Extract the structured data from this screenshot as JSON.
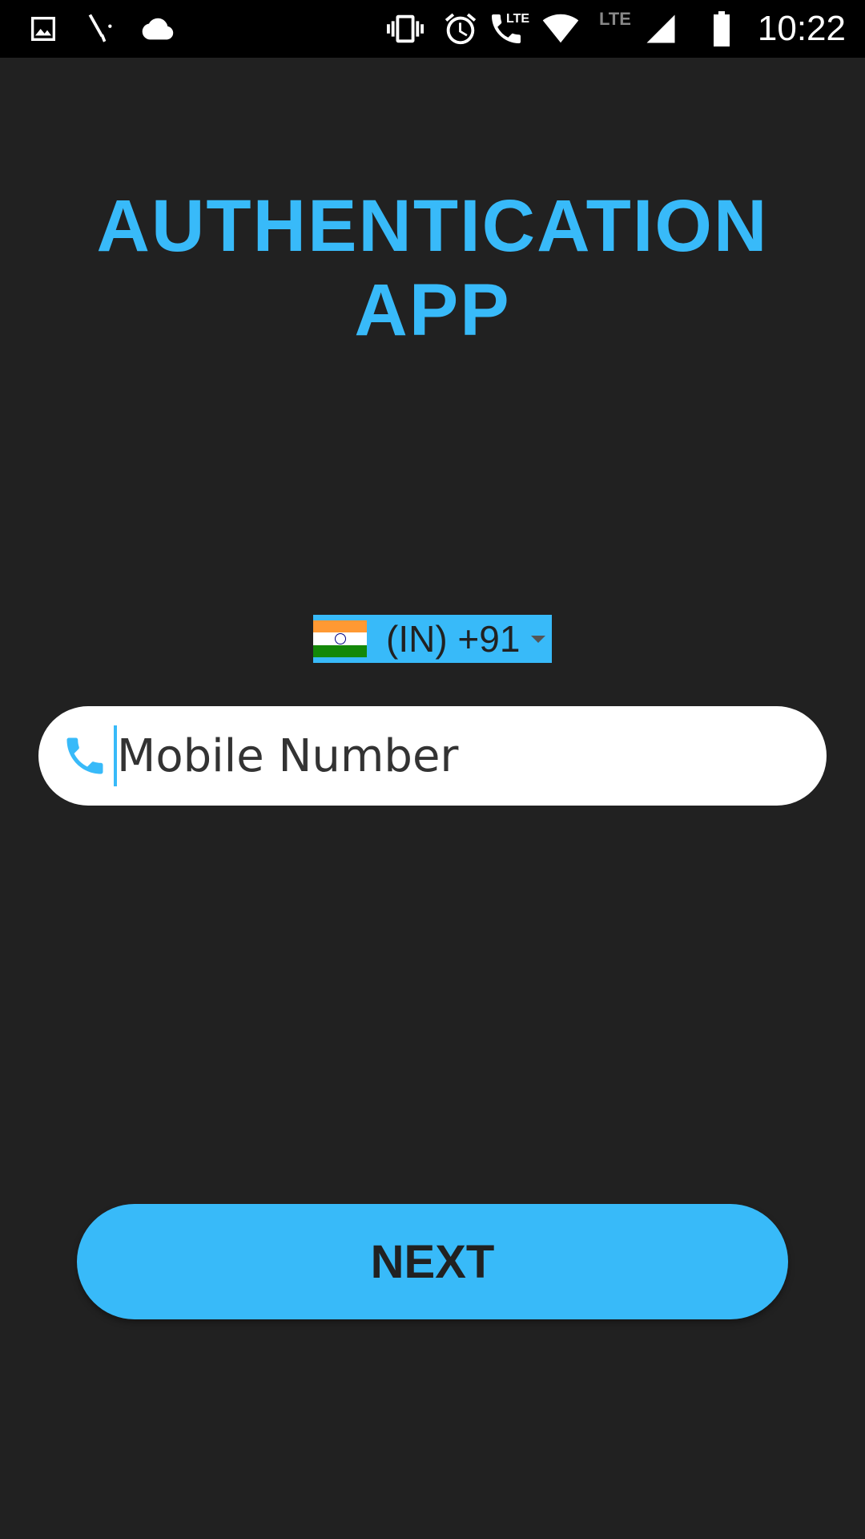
{
  "colors": {
    "accent": "#38BAF9",
    "background": "#212121",
    "statusbar": "#000000",
    "field_bg": "#FFFFFF",
    "button_text": "#212121"
  },
  "status_bar": {
    "time": "10:22",
    "icons": [
      "image-icon",
      "tool-icon",
      "cloud-icon",
      "vibrate-icon",
      "alarm-icon",
      "volte-call-icon",
      "wifi-icon",
      "lte-signal-icon",
      "battery-icon"
    ],
    "lte_label": "LTE"
  },
  "app": {
    "title": "AUTHENTICATION APP"
  },
  "country_picker": {
    "country": "India",
    "label": "(IN) +91"
  },
  "phone_field": {
    "placeholder": "Mobile Number",
    "value": ""
  },
  "next_button": {
    "label": "NEXT"
  }
}
